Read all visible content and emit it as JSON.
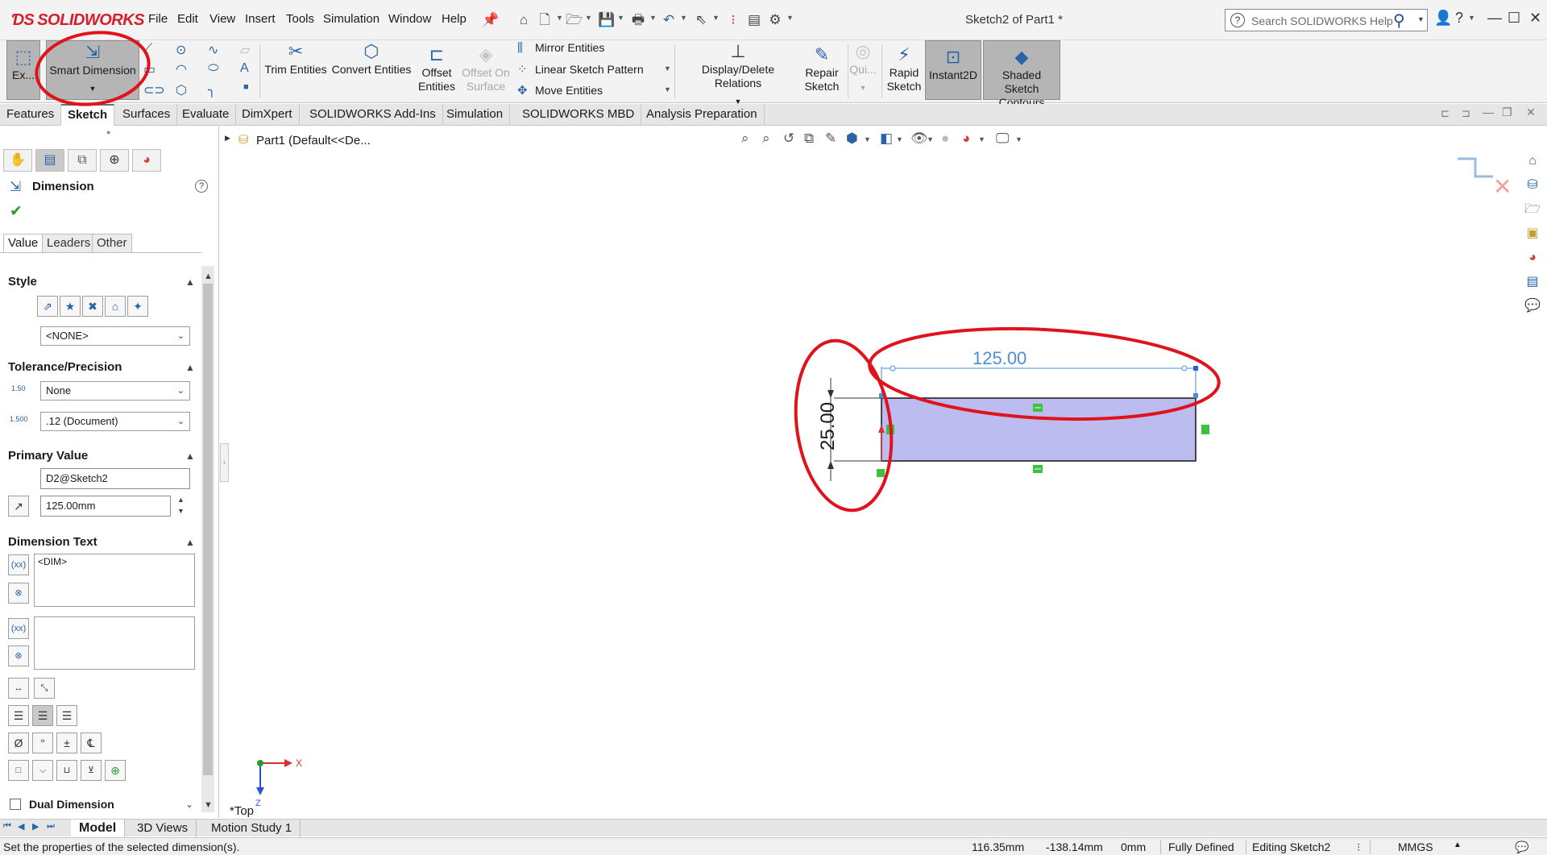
{
  "app": {
    "brand": "SOLIDWORKS",
    "document_title": "Sketch2 of Part1 *",
    "menu": [
      "File",
      "Edit",
      "View",
      "Insert",
      "Tools",
      "Simulation",
      "Window",
      "Help"
    ],
    "search_placeholder": "Search SOLIDWORKS Help"
  },
  "ribbon": {
    "exit_sketch": "Ex...",
    "smart_dimension": "Smart Dimension",
    "trim_entities": "Trim Entities",
    "convert_entities": "Convert Entities",
    "offset_entities": [
      "Offset",
      "Entities"
    ],
    "offset_on_surface": [
      "Offset On",
      "Surface"
    ],
    "mirror_entities": "Mirror Entities",
    "linear_sketch_pattern": "Linear Sketch Pattern",
    "move_entities": "Move Entities",
    "display_delete_relations": "Display/Delete Relations",
    "repair_sketch": [
      "Repair",
      "Sketch"
    ],
    "quick_snaps": "Qui...",
    "rapid_sketch": [
      "Rapid",
      "Sketch"
    ],
    "instant2d": "Instant2D",
    "shaded_sketch_contours": [
      "Shaded Sketch",
      "Contours"
    ]
  },
  "tabs": [
    "Features",
    "Sketch",
    "Surfaces",
    "Evaluate",
    "DimXpert",
    "SOLIDWORKS Add-Ins",
    "Simulation",
    "SOLIDWORKS MBD",
    "Analysis Preparation"
  ],
  "property_manager": {
    "title": "Dimension",
    "subtabs": [
      "Value",
      "Leaders",
      "Other"
    ],
    "style": {
      "label": "Style",
      "value": "<NONE>"
    },
    "tolerance": {
      "label": "Tolerance/Precision",
      "tolerance_value": "None",
      "precision_value": ".12 (Document)",
      "tol_icon_text": "1.50",
      "prec_icon_text": "1.500"
    },
    "primary_value": {
      "label": "Primary Value",
      "name": "D2@Sketch2",
      "value": "125.00mm"
    },
    "dimension_text": {
      "label": "Dimension Text",
      "text": "<DIM>"
    },
    "symbols": [
      "Ø",
      "°",
      "±",
      "℄"
    ],
    "dual_dimension": "Dual Dimension"
  },
  "feature_tree": {
    "root": "Part1  (Default<<De..."
  },
  "sketch": {
    "horizontal_dim": "125.00",
    "vertical_dim": "25.00",
    "view_label": "*Top",
    "triad_x": "X",
    "triad_z": "Z"
  },
  "bottom_tabs": [
    "Model",
    "3D Views",
    "Motion Study 1"
  ],
  "status": {
    "message": "Set the properties of the selected dimension(s).",
    "x": "116.35mm",
    "y": "-138.14mm",
    "z": "0mm",
    "state": "Fully Defined",
    "editing": "Editing Sketch2",
    "units": "MMGS"
  },
  "colors": {
    "sketch_fill": "#bcbcf0",
    "annotation_red": "#e0121b",
    "dimension_blue": "#4a90d9",
    "relation_green": "#3fc13f",
    "accent": "#2a64a6"
  }
}
